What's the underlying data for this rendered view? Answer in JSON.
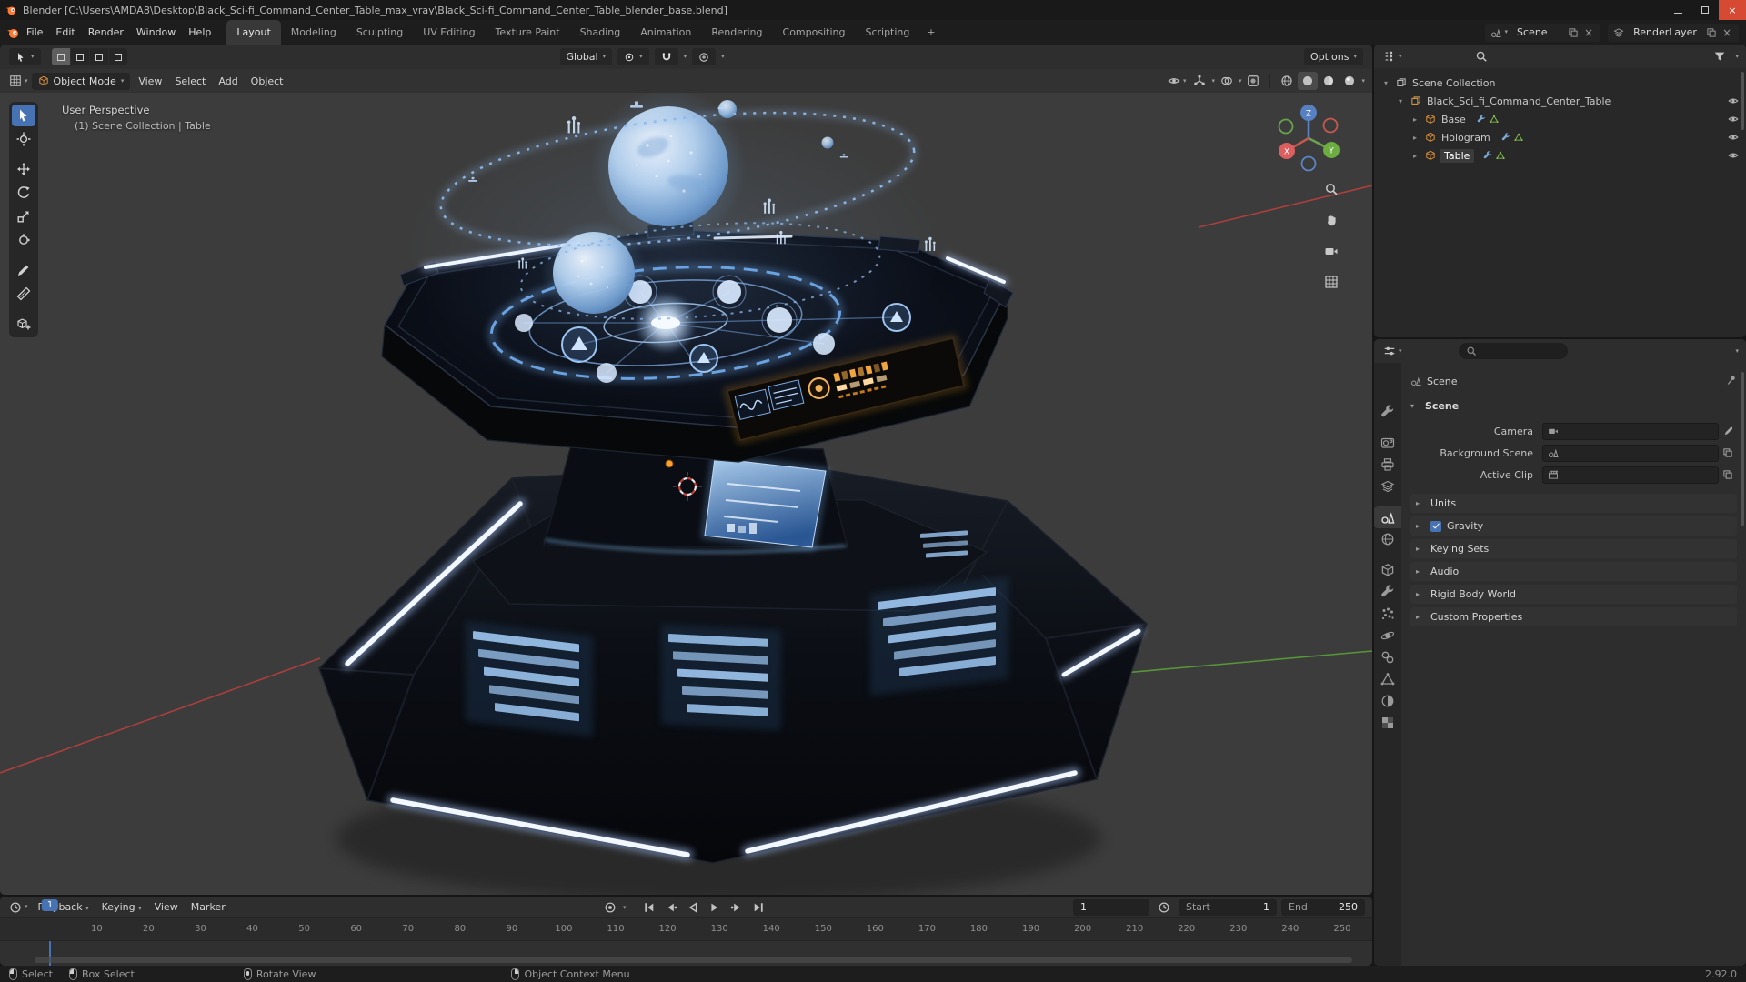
{
  "window": {
    "title": "Blender  [C:\\Users\\AMDA8\\Desktop\\Black_Sci-fi_Command_Center_Table_max_vray\\Black_Sci-fi_Command_Center_Table_blender_base.blend]"
  },
  "colors": {
    "accent_blue": "#4772b3",
    "object_orange": "#e0923c",
    "mesh_green": "#8bd34f",
    "holo_blue": "#9fc4f0"
  },
  "topbar": {
    "menus": [
      "File",
      "Edit",
      "Render",
      "Window",
      "Help"
    ],
    "workspaces": [
      {
        "label": "Layout",
        "active": true
      },
      {
        "label": "Modeling"
      },
      {
        "label": "Sculpting"
      },
      {
        "label": "UV Editing"
      },
      {
        "label": "Texture Paint"
      },
      {
        "label": "Shading"
      },
      {
        "label": "Animation"
      },
      {
        "label": "Rendering"
      },
      {
        "label": "Compositing"
      },
      {
        "label": "Scripting"
      }
    ],
    "add_workspace": "+",
    "scene_field": "Scene",
    "view_layer_field": "RenderLayer"
  },
  "tool_settings": {
    "orientation": "Global",
    "options": "Options"
  },
  "viewport_header": {
    "mode": "Object Mode",
    "menus": [
      "View",
      "Select",
      "Add",
      "Object"
    ],
    "shading": [
      {
        "icon": "i-shade-wire",
        "name": "wireframe"
      },
      {
        "icon": "i-shade-solid",
        "name": "solid",
        "active": true
      },
      {
        "icon": "i-shade-mat",
        "name": "material-preview"
      },
      {
        "icon": "i-shade-rend",
        "name": "rendered"
      }
    ]
  },
  "viewport": {
    "view_label": "User Perspective",
    "context_label": "(1) Scene Collection | Table",
    "tools": [
      {
        "icon": "i-arrow",
        "name": "select-box",
        "active": true
      },
      {
        "icon": "i-cursorx",
        "name": "cursor"
      },
      {
        "icon": "i-move",
        "name": "move",
        "gap": true
      },
      {
        "icon": "i-rotate",
        "name": "rotate"
      },
      {
        "icon": "i-scale",
        "name": "scale"
      },
      {
        "icon": "i-transform",
        "name": "transform"
      },
      {
        "icon": "i-pen",
        "name": "annotate",
        "gap": true
      },
      {
        "icon": "i-ruler",
        "name": "measure"
      },
      {
        "icon": "i-addcube",
        "name": "add-cube",
        "gap": true
      }
    ],
    "nav_icons": [
      {
        "icon": "i-magnifier",
        "name": "zoom"
      },
      {
        "icon": "i-hand",
        "name": "pan"
      },
      {
        "icon": "i-camera",
        "name": "camera-view"
      },
      {
        "icon": "i-grid",
        "name": "toggle-ortho"
      }
    ]
  },
  "outliner": {
    "rows": [
      {
        "label": "Scene Collection",
        "caret": "▾",
        "icon": "i-collection",
        "kind": "k-root",
        "depth": "d0"
      },
      {
        "label": "Black_Sci_fi_Command_Center_Table",
        "caret": "▾",
        "icon": "i-collection",
        "kind": "k-col",
        "depth": "d1",
        "eye": true
      },
      {
        "label": "Base",
        "caret": "▸",
        "icon": "i-cube",
        "kind": "k-obj",
        "depth": "d2",
        "extras": true,
        "eye": true
      },
      {
        "label": "Hologram",
        "caret": "▸",
        "icon": "i-cube",
        "kind": "k-obj",
        "depth": "d2",
        "extras": true,
        "eye": true
      },
      {
        "label": "Table",
        "caret": "▸",
        "icon": "i-cube",
        "kind": "k-obj",
        "depth": "d2",
        "extras": true,
        "eye": true,
        "active": true
      }
    ]
  },
  "properties": {
    "breadcrumb": "Scene",
    "tabs": [
      {
        "icon": "i-wrench",
        "name": "tool"
      },
      {
        "icon": "pt-render",
        "name": "render",
        "gap": true
      },
      {
        "icon": "pt-output",
        "name": "output"
      },
      {
        "icon": "i-layers",
        "name": "view-layer"
      },
      {
        "icon": "i-scene",
        "name": "scene",
        "gap": true,
        "active": true
      },
      {
        "icon": "i-shade-wire",
        "name": "world"
      },
      {
        "icon": "i-cube",
        "name": "object",
        "gap": true,
        "cls": "c-orange"
      },
      {
        "icon": "i-wrench",
        "name": "modifiers",
        "cls": "c-blue"
      },
      {
        "icon": "pt-particles",
        "name": "particles",
        "cls": "c-blue"
      },
      {
        "icon": "pt-physics",
        "name": "physics",
        "cls": "c-blue"
      },
      {
        "icon": "pt-constraints",
        "name": "constraints",
        "cls": "c-blue"
      },
      {
        "icon": "i-mesh",
        "name": "object-data",
        "cls": "c-green"
      },
      {
        "icon": "pt-material",
        "name": "material",
        "cls": "c-maroon"
      },
      {
        "icon": "pt-texture",
        "name": "texture",
        "cls": "c-red"
      }
    ],
    "scene_panel": {
      "title": "Scene",
      "fields": [
        {
          "label": "Camera",
          "icon": "i-camera",
          "dropper": true
        },
        {
          "label": "Background Scene",
          "icon": "i-scene",
          "new": true
        },
        {
          "label": "Active Clip",
          "icon": "i-clip",
          "new": true
        }
      ]
    },
    "sections": [
      {
        "label": "Units"
      },
      {
        "label": "Gravity",
        "checkbox": true
      },
      {
        "label": "Keying Sets"
      },
      {
        "label": "Audio"
      },
      {
        "label": "Rigid Body World"
      },
      {
        "label": "Custom Properties"
      }
    ]
  },
  "timeline": {
    "menus": [
      {
        "label": "Playback",
        "caret": true
      },
      {
        "label": "Keying",
        "caret": true
      },
      {
        "label": "View"
      },
      {
        "label": "Marker"
      }
    ],
    "transport": [
      {
        "icon": "tr-start",
        "name": "jump-to-start"
      },
      {
        "icon": "tr-prevkey",
        "name": "jump-to-prev-keyframe"
      },
      {
        "icon": "tr-revplay",
        "name": "play-reverse"
      },
      {
        "icon": "tr-play",
        "name": "play"
      },
      {
        "icon": "tr-nextkey",
        "name": "jump-to-next-keyframe"
      },
      {
        "icon": "tr-end",
        "name": "jump-to-end"
      }
    ],
    "current_frame": "1",
    "frame_field": "1",
    "start_label": "Start",
    "start_value": "1",
    "end_label": "End",
    "end_value": "250",
    "ruler": {
      "frames": [
        10,
        20,
        30,
        40,
        50,
        60,
        70,
        80,
        90,
        100,
        110,
        120,
        130,
        140,
        150,
        160,
        170,
        180,
        190,
        200,
        210,
        220,
        230,
        240,
        250
      ]
    }
  },
  "statusbar": {
    "hints": [
      {
        "label": "Select",
        "mouse": "m-left"
      },
      {
        "label": "Box Select",
        "mouse": "m-left"
      },
      {
        "label": "Rotate View",
        "mouse": "m-mid"
      },
      {
        "label": "Object Context Menu",
        "mouse": "m-right"
      }
    ],
    "version": "2.92.0"
  }
}
